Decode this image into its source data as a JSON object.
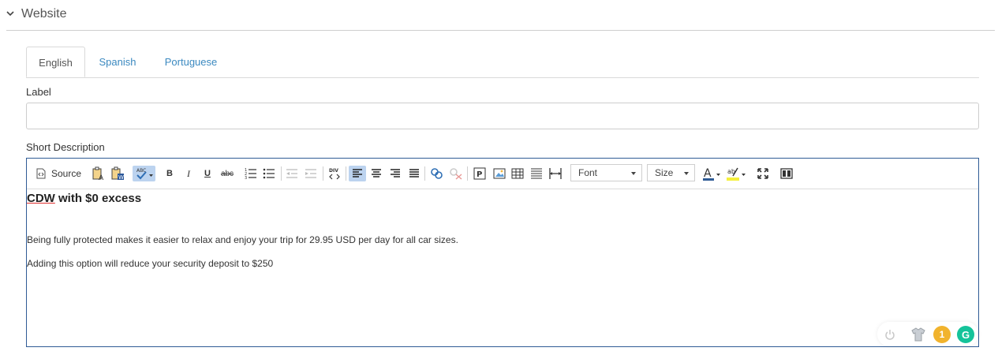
{
  "section": {
    "title": "Website"
  },
  "tabs": [
    {
      "label": "English",
      "active": true
    },
    {
      "label": "Spanish",
      "active": false
    },
    {
      "label": "Portuguese",
      "active": false
    }
  ],
  "label_field": {
    "label": "Label",
    "value": "",
    "placeholder": ""
  },
  "description_field": {
    "label": "Short Description"
  },
  "toolbar": {
    "source_label": "Source",
    "font_combo": "Font",
    "size_combo": "Size",
    "bold": "B",
    "italic": "I",
    "underline": "U",
    "strike": "abc"
  },
  "editor_content": {
    "heading_word1": "CDW",
    "heading_rest": " with $0 excess",
    "paragraph1": "Being fully protected makes it easier to relax and enjoy your trip for 29.95 USD per day for all car sizes.",
    "paragraph2": "Adding this option will reduce your security deposit to $250"
  },
  "widgets": {
    "notification_count": "1",
    "grammarly_letter": "G"
  },
  "colors": {
    "link": "#3b89c0",
    "editor_border": "#2f5b95",
    "active_button": "#bcd3ef",
    "badge": "#f1b32d",
    "grammarly": "#15c39a"
  }
}
